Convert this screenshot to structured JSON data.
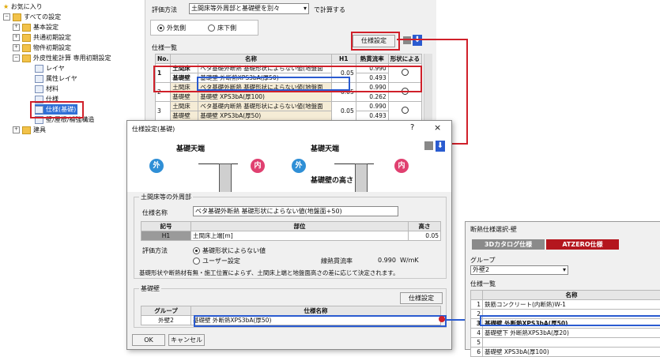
{
  "tree": {
    "items": [
      {
        "label": "お気に入り",
        "toggle": "",
        "icon": "star"
      },
      {
        "label": "すべての設定",
        "toggle": "−",
        "icon": "folder"
      },
      {
        "label": "基本設定",
        "toggle": "+",
        "icon": "folder"
      },
      {
        "label": "共通初期設定",
        "toggle": "+",
        "icon": "folder"
      },
      {
        "label": "物件初期設定",
        "toggle": "+",
        "icon": "folder"
      },
      {
        "label": "外皮性能計算 専用初期設定",
        "toggle": "−",
        "icon": "folder"
      },
      {
        "label": "レイヤ",
        "toggle": "",
        "icon": "doc"
      },
      {
        "label": "属性レイヤ",
        "toggle": "",
        "icon": "doc"
      },
      {
        "label": "材料",
        "toggle": "",
        "icon": "doc"
      },
      {
        "label": "仕様",
        "toggle": "",
        "icon": "doc"
      },
      {
        "label": "仕様(基礎)",
        "toggle": "",
        "icon": "doc",
        "selected": true
      },
      {
        "label": "壁/屋根/補強構造",
        "toggle": "",
        "icon": "doc"
      },
      {
        "label": "建具",
        "toggle": "+",
        "icon": "folder"
      }
    ]
  },
  "top_panel": {
    "eval_label": "評価方法",
    "eval_value": "土間床等外周部と基礎壁を別々",
    "eval_suffix": "で計算する",
    "radio_outer": "外気側",
    "radio_under": "床下側",
    "spec_button": "仕様設定",
    "list_label": "仕様一覧",
    "headers": {
      "no": "No.",
      "name": "名称",
      "h1": "H1",
      "flow": "熱貫流率",
      "shape": "形状による"
    },
    "rows": [
      {
        "no": "1",
        "k1": "土間床",
        "v1": "ベタ基礎外断熱 基礎形状によらない値(地盤面",
        "k2": "基礎壁",
        "v2": "基礎壁 外断熱XPS3bA(厚50)",
        "h1": "0.05",
        "f1": "0.990",
        "f2": "0.493"
      },
      {
        "no": "2",
        "k1": "土間床",
        "v1": "ベタ基礎外断熱 基礎形状によらない値(地盤面",
        "k2": "基礎壁",
        "v2": "基礎壁 XPS3bA(厚100)",
        "h1": "0.05",
        "f1": "0.990",
        "f2": "0.262"
      },
      {
        "no": "3",
        "k1": "土間床",
        "v1": "ベタ基礎内断熱 基礎形状によらない値(地盤面",
        "k2": "基礎壁",
        "v2": "基礎壁 XPS3bA(厚50)",
        "h1": "0.05",
        "f1": "0.990",
        "f2": "0.493"
      }
    ]
  },
  "dialog": {
    "title": "仕様設定(基礎)",
    "help": "?",
    "close": "×",
    "diagram": {
      "top_label": "基礎天端",
      "out": "外",
      "in": "内",
      "height_label": "基礎壁の高さ"
    },
    "section1": "土間床等の外周部",
    "spec_name_label": "仕様名称",
    "spec_name_value": "ベタ基礎外断熱 基礎形状によらない値(地盤面+50)",
    "table_headers": {
      "code": "記号",
      "part": "部位",
      "height": "高さ"
    },
    "table_row": {
      "code": "H1",
      "part": "土間床上端[m]",
      "height": "0.05"
    },
    "eval_label": "評価方法",
    "radio1": "基礎形状によらない値",
    "radio2": "ユーザー設定",
    "flow_label": "線熱貫流率",
    "flow_value": "0.990",
    "flow_unit": "W/mK",
    "note": "基礎形状や断熱材有無・施工位置によらず、土間床上端と地盤面高さの差に応じて決定されます。",
    "section2": "基礎壁",
    "spec_button": "仕様設定",
    "wall_headers": {
      "group": "グループ",
      "name": "仕様名称"
    },
    "wall_row": {
      "group": "外壁2",
      "name": "基礎壁 外断熱XPS3bA(厚50)"
    },
    "ok": "OK",
    "cancel": "キャンセル"
  },
  "right_dialog": {
    "title": "断熱仕様選択-壁",
    "tab1": "3Dカタログ仕様",
    "tab2": "ATZERO仕様",
    "group_label": "グループ",
    "group_value": "外壁2",
    "list_label": "仕様一覧",
    "header_name": "名称",
    "rows": [
      {
        "no": "1",
        "name": "鉄筋コンクリート(内断熱)W-1"
      },
      {
        "no": "2",
        "name": ""
      },
      {
        "no": "3",
        "name": "基礎壁 外断熱XPS3bA(厚50)"
      },
      {
        "no": "4",
        "name": "基礎壁下 外断熱XPS3bA(厚20)"
      },
      {
        "no": "5",
        "name": ""
      },
      {
        "no": "6",
        "name": "基礎壁 XPS3bA(厚100)"
      }
    ]
  },
  "colors": {
    "red": "#d0202a",
    "blue": "#2a5bd0",
    "atzero": "#b4161e",
    "tabgray": "#8a8a8a"
  }
}
